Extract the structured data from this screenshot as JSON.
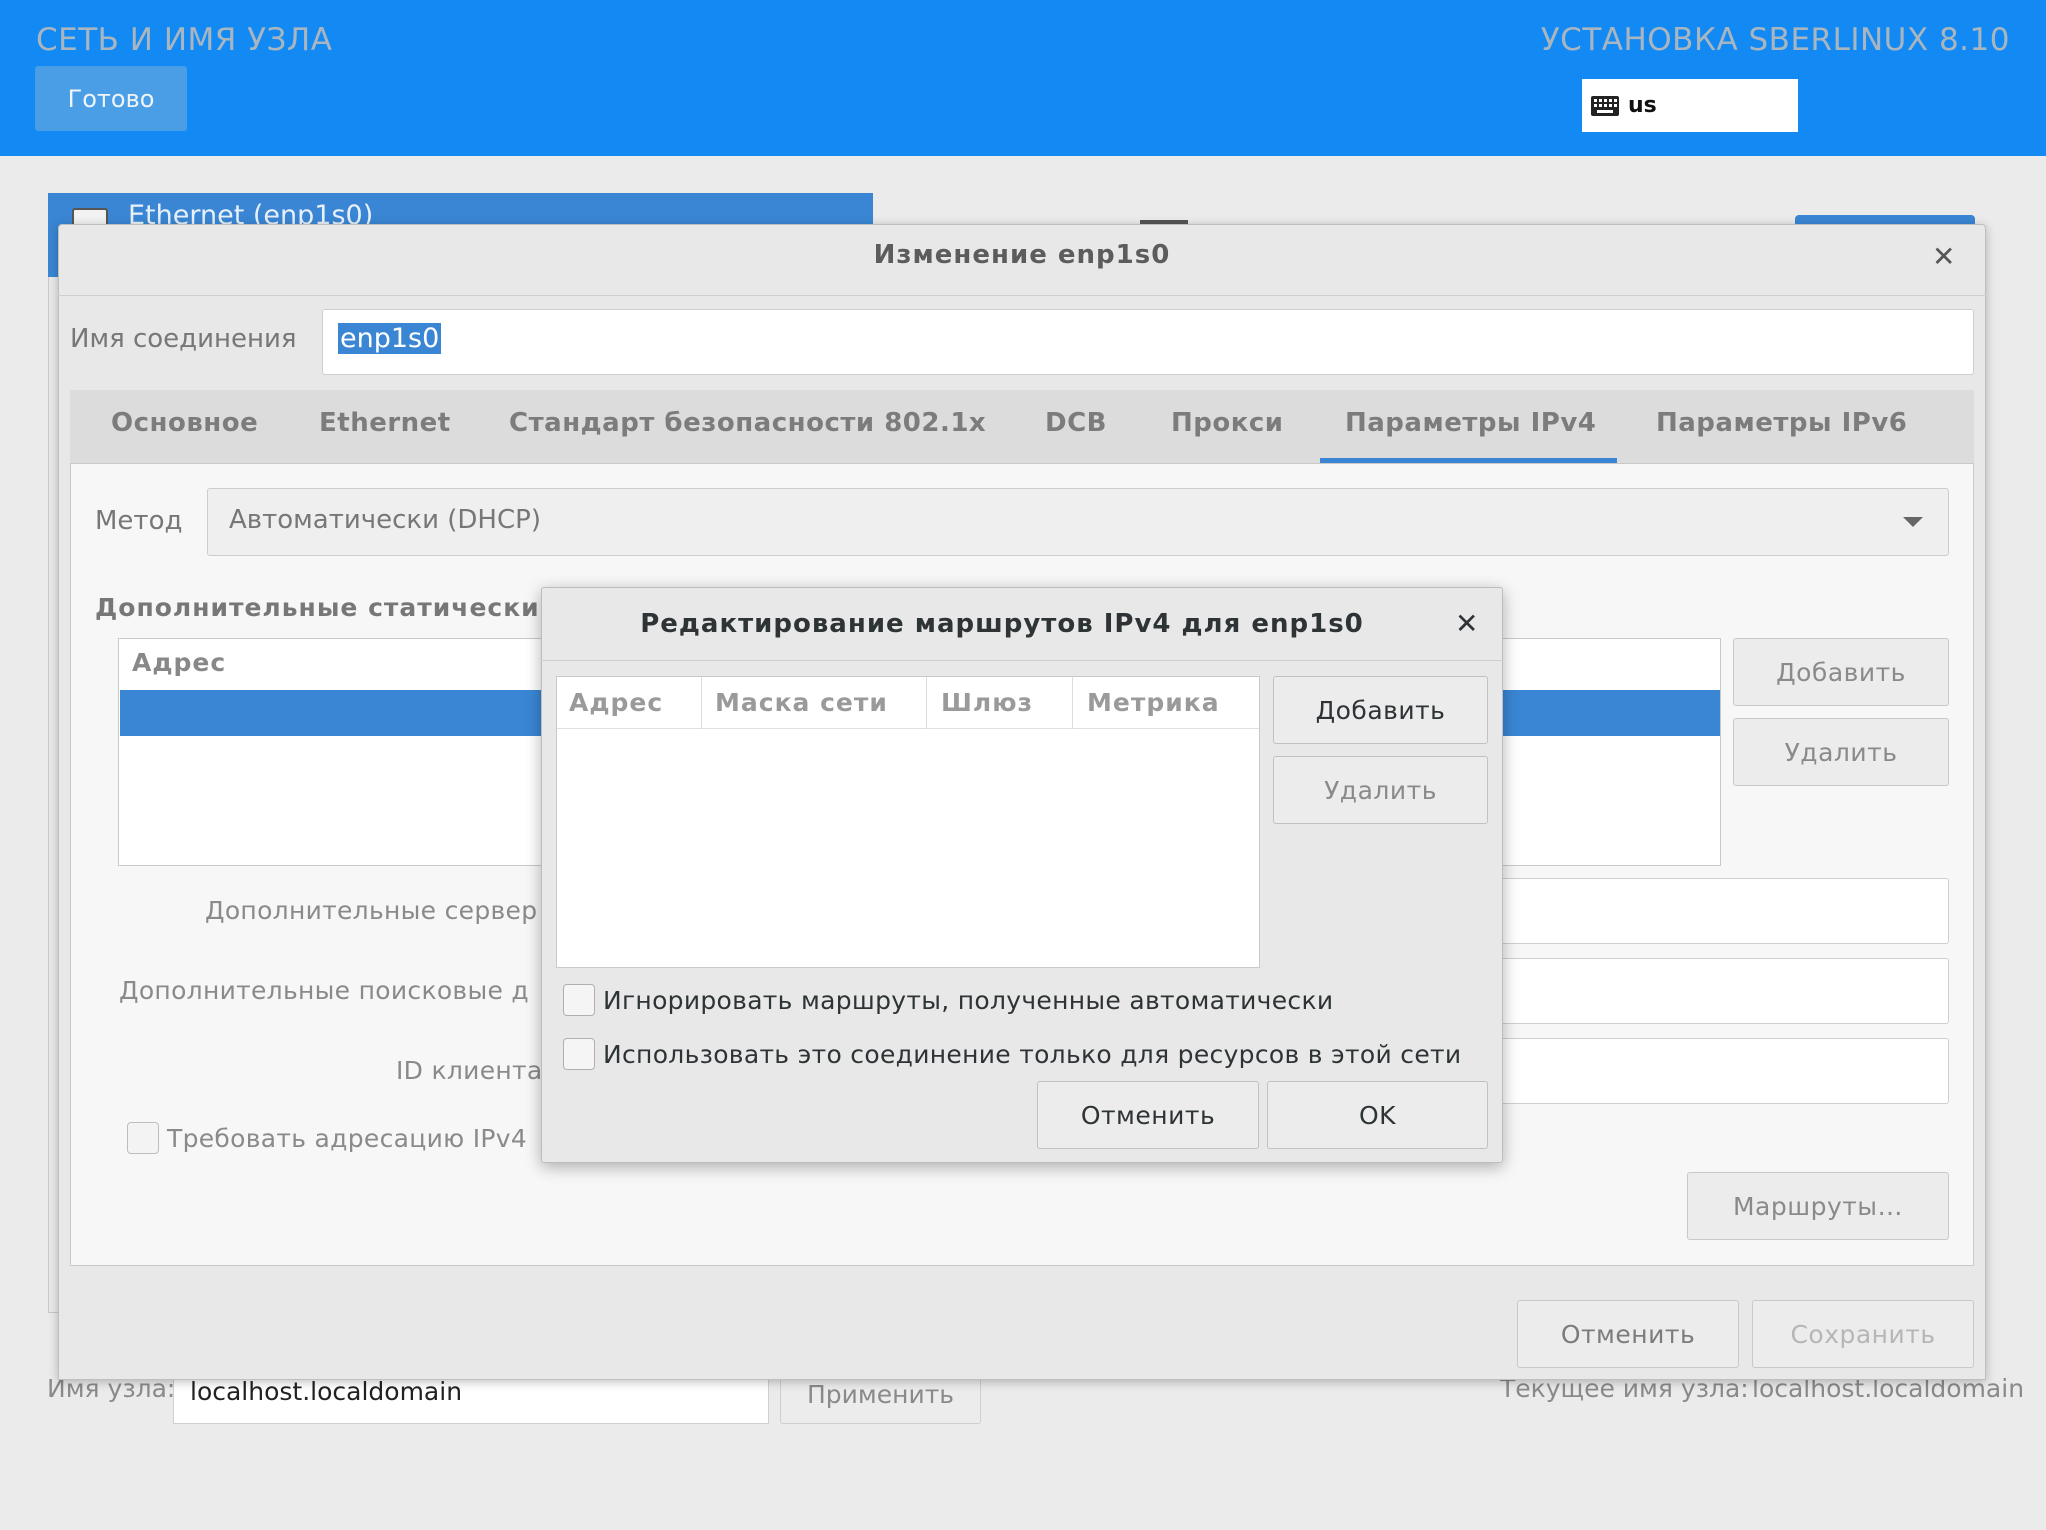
{
  "installer": {
    "spoke_title": "СЕТЬ И ИМЯ УЗЛА",
    "product_title": "УСТАНОВКА SBERLINUX 8.10",
    "done_label": "Готово",
    "keyboard_layout": "us"
  },
  "spoke": {
    "device_label": "Ethernet (enp1s0)",
    "hostname_label": "Имя узла:",
    "hostname_value": "localhost.localdomain",
    "apply_label": "Применить",
    "current_hostname_label": "Текущее имя узла:",
    "current_hostname_value": "localhost.localdomain"
  },
  "edit_dialog": {
    "title": "Изменение enp1s0",
    "connection_name_label": "Имя соединения",
    "connection_name_value": "enp1s0",
    "tabs": [
      {
        "label": "Основное"
      },
      {
        "label": "Ethernet"
      },
      {
        "label": "Стандарт безопасности 802.1x"
      },
      {
        "label": "DCB"
      },
      {
        "label": "Прокси"
      },
      {
        "label": "Параметры IPv4",
        "active": true
      },
      {
        "label": "Параметры IPv6"
      }
    ],
    "ipv4": {
      "method_label": "Метод",
      "method_value": "Автоматически (DHCP)",
      "static_addresses_label": "Дополнительные статически",
      "address_column": "Адрес",
      "add_label": "Добавить",
      "delete_label": "Удалить",
      "dns_label": "Дополнительные сервер",
      "search_domains_label": "Дополнительные поисковые д",
      "client_id_label": "ID клиента",
      "require_ipv4_label": "Требовать адресацию IPv4",
      "routes_label": "Маршруты…"
    },
    "cancel_label": "Отменить",
    "save_label": "Сохранить"
  },
  "routes_dialog": {
    "title": "Редактирование маршрутов IPv4 для enp1s0",
    "columns": [
      "Адрес",
      "Маска сети",
      "Шлюз",
      "Метрика"
    ],
    "rows": [],
    "add_label": "Добавить",
    "delete_label": "Удалить",
    "ignore_auto_routes_label": "Игнорировать маршруты, полученные автоматически",
    "ignore_auto_routes_checked": false,
    "only_local_resources_label": "Использовать это соединение только для ресурсов в этой сети",
    "only_local_resources_checked": false,
    "cancel_label": "Отменить",
    "ok_label": "OK"
  },
  "colors": {
    "header_blue": "#1389f3",
    "selection_blue": "#3a86d4"
  }
}
